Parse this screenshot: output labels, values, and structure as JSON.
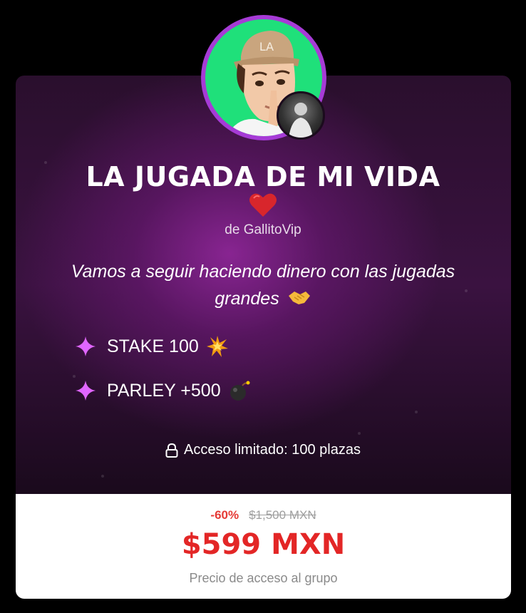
{
  "offer": {
    "title": "LA JUGADA DE MI VIDA",
    "title_emoji": "heart-icon",
    "byline": "de GallitoVip",
    "description": "Vamos a seguir haciendo dinero con las jugadas grandes",
    "description_emoji": "handshake-icon",
    "features": [
      {
        "label": "STAKE 100",
        "icon": "collision-icon"
      },
      {
        "label": "PARLEY +500",
        "icon": "bomb-icon"
      }
    ],
    "access_text": "Acceso limitado: 100 plazas"
  },
  "pricing": {
    "discount": "-60%",
    "old_price": "$1,500 MXN",
    "new_price": "$599 MXN",
    "caption": "Precio de acceso al grupo"
  },
  "colors": {
    "accent_pink": "#e066ff",
    "price_red": "#e32626",
    "avatar_ring": "#a63bd6",
    "avatar_bg": "#1fe07a"
  }
}
